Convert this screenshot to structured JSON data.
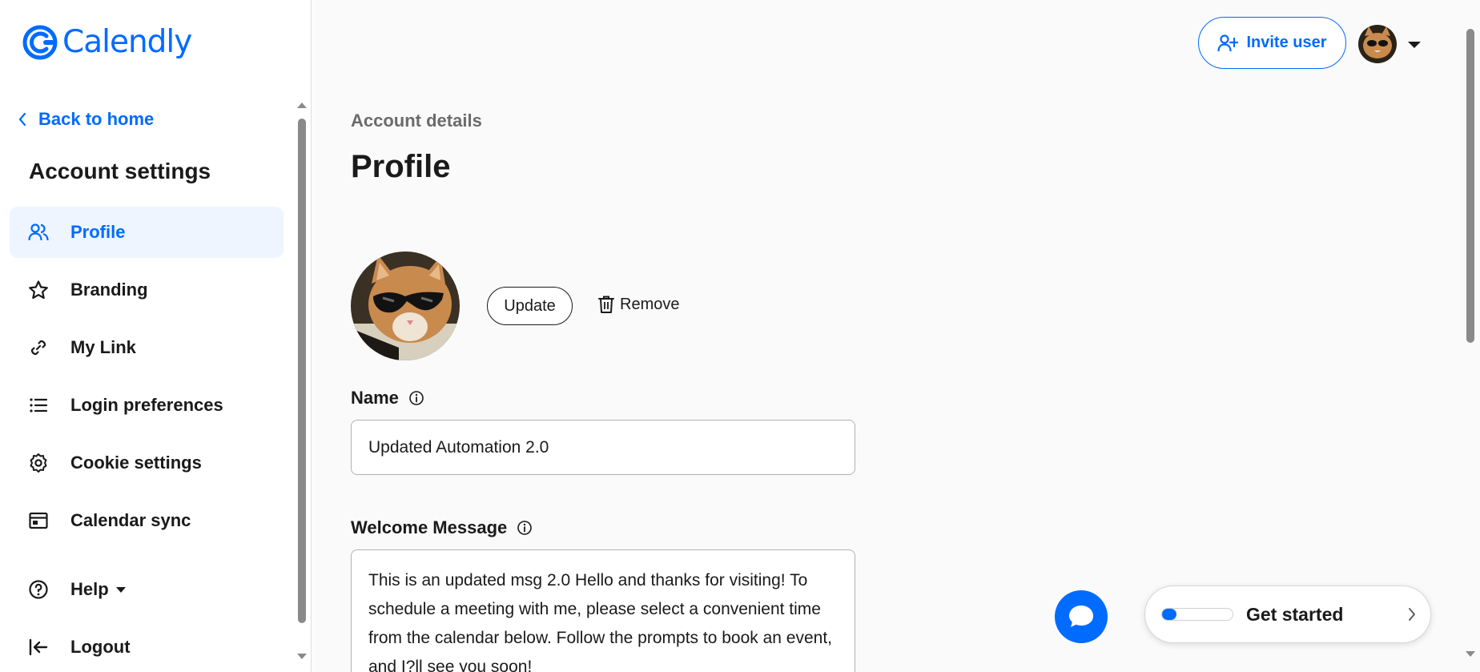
{
  "app": {
    "name": "Calendly",
    "brand_color": "#006bff"
  },
  "sidebar": {
    "back_label": "Back to home",
    "section_title": "Account settings",
    "items": [
      {
        "label": "Profile",
        "icon": "users-icon",
        "active": true
      },
      {
        "label": "Branding",
        "icon": "star-icon"
      },
      {
        "label": "My Link",
        "icon": "link-icon"
      },
      {
        "label": "Login preferences",
        "icon": "list-icon"
      },
      {
        "label": "Cookie settings",
        "icon": "gear-icon"
      },
      {
        "label": "Calendar sync",
        "icon": "calendar-icon"
      },
      {
        "label": "Help",
        "icon": "help-circle-icon"
      },
      {
        "label": "Logout",
        "icon": "logout-icon"
      }
    ]
  },
  "header": {
    "invite_label": "Invite user"
  },
  "main": {
    "breadcrumb": "Account details",
    "title": "Profile",
    "photo": {
      "update_label": "Update",
      "remove_label": "Remove"
    },
    "name": {
      "label": "Name",
      "value": "Updated Automation 2.0"
    },
    "welcome": {
      "label": "Welcome Message",
      "value": "This is an updated msg 2.0 Hello and thanks for visiting! To schedule a meeting with me, please select a convenient time from the calendar below. Follow the prompts to book an event, and I?ll see you soon!"
    }
  },
  "widgets": {
    "get_started_label": "Get started",
    "get_started_progress": 0.2
  }
}
